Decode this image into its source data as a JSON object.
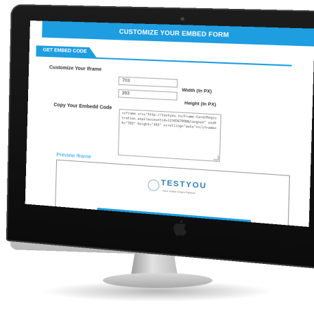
{
  "header": {
    "title": "CUSTOMIZE YOUR EMBED FORM"
  },
  "section": {
    "tab_label": "GET EMBED CODE"
  },
  "form": {
    "iframe_label": "Customize Your Iframe",
    "width_value": "703",
    "width_unit": "Width (In PX)",
    "height_value": "393",
    "height_unit": "Height (In PX)",
    "embed_label": "Copy Your Embedd Code",
    "embed_code": "<iframe src=\"http://testyou.in/Frame-Card/Registration.aspx?accountid=1234567890&lang=en\" width=\"703\" height=\"393\" scrolling=\"auto\"></iframe>"
  },
  "preview": {
    "label": "Preview Iframe",
    "brand_name": "TESTYOU",
    "brand_tagline": "Your online Exam Partner"
  },
  "colors": {
    "accent": "#1e9de0",
    "brand_text": "#2f7fb3"
  }
}
